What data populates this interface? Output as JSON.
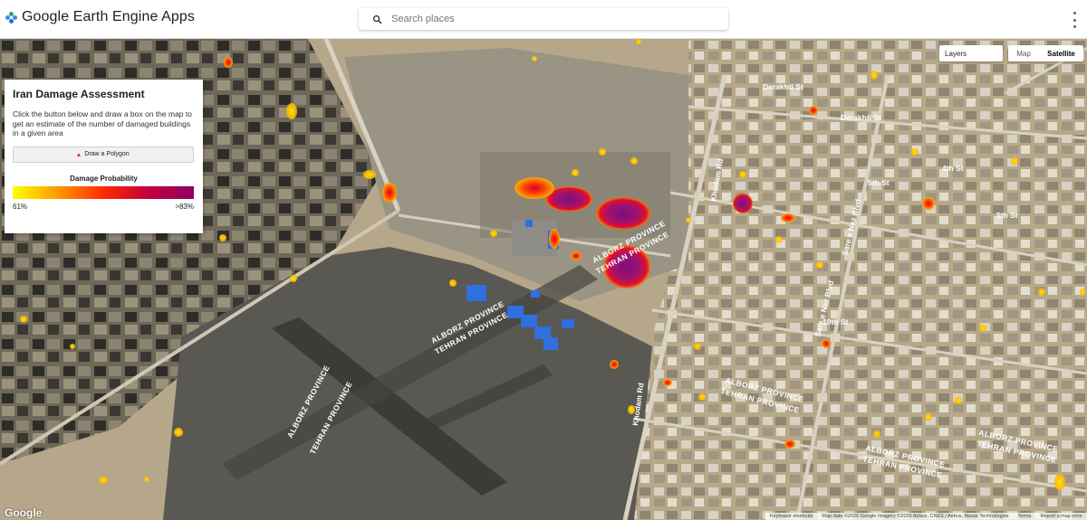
{
  "header": {
    "app_title": "Google Earth Engine Apps",
    "search_placeholder": "Search places",
    "icons": [
      "earth-engine-logo-icon",
      "search-icon",
      "more-vert-icon"
    ]
  },
  "map": {
    "layers_label": "Layers",
    "type_options": [
      "Map",
      "Satellite"
    ],
    "selected_type": "Satellite",
    "labels": {
      "derakhti_st_1": "Derakhti St",
      "derakhti_st_2": "Derakhti St",
      "fourth_st": "4th St",
      "fifth_st_1": "5th St",
      "fifth_st_2": "5th St",
      "tenth_st": "10th St",
      "khodam_rd_1": "Khodam Rd",
      "khodam_rd_2": "Khodam Rd",
      "sare_naz_1": "Sare e Naz Blvd",
      "sare_naz_2": "Sare e Naz Blvd",
      "province_line1": "ALBORZ PROVINCE",
      "province_line2": "TEHRAN PROVINCE"
    },
    "google_logo": "Google",
    "attribution": [
      "Keyboard shortcuts",
      "Map data ©2026 Google Imagery ©2026 Airbus, CNES / Airbus, Maxar Technologies",
      "Terms",
      "Report a map error"
    ]
  },
  "panel": {
    "title": "Iran Damage Assessment",
    "description": "Click the button below and draw a box on the map to get an estimate of the number of damaged buildings in a given area",
    "draw_button_label": "Draw a Polygon",
    "legend": {
      "title": "Damage Probability",
      "min_label": "61%",
      "max_label": ">83%",
      "colors": [
        "#ffff00",
        "#ff9900",
        "#ff2a00",
        "#c4003c",
        "#8e0066"
      ]
    }
  }
}
